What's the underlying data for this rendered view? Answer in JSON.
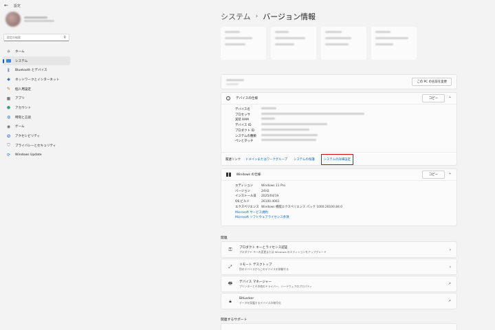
{
  "titlebar": {
    "back": "←",
    "title": "設定"
  },
  "search": {
    "placeholder": "設定の検索"
  },
  "sidebar": {
    "items": [
      {
        "label": "ホーム",
        "icon": "home-icon"
      },
      {
        "label": "システム",
        "icon": "monitor-icon"
      },
      {
        "label": "Bluetooth とデバイス",
        "icon": "bluetooth-icon"
      },
      {
        "label": "ネットワークとインターネット",
        "icon": "wifi-icon"
      },
      {
        "label": "個人用設定",
        "icon": "brush-icon"
      },
      {
        "label": "アプリ",
        "icon": "apps-icon"
      },
      {
        "label": "アカウント",
        "icon": "person-icon"
      },
      {
        "label": "時刻と言語",
        "icon": "globe-icon"
      },
      {
        "label": "ゲーム",
        "icon": "gamepad-icon"
      },
      {
        "label": "アクセシビリティ",
        "icon": "accessibility-icon"
      },
      {
        "label": "プライバシーとセキュリティ",
        "icon": "shield-icon"
      },
      {
        "label": "Windows Update",
        "icon": "update-icon"
      }
    ]
  },
  "header": {
    "system": "システム",
    "separator": "›",
    "page": "バージョン情報"
  },
  "rename_button": "この PC の名前を変更",
  "device_specs": {
    "title": "デバイスの仕様",
    "copy": "コピー",
    "labels": [
      "デバイス名",
      "プロセッサ",
      "実装 RAM",
      "デバイス ID",
      "プロダクト ID",
      "システムの種類",
      "ペンとタッチ"
    ]
  },
  "related_links": {
    "label": "関連リンク",
    "links": [
      "ドメインまたはワークグループ",
      "システムの保護",
      "システムの詳細設定"
    ]
  },
  "windows_specs": {
    "title": "Windows の仕様",
    "copy": "コピー",
    "rows": [
      {
        "label": "エディション",
        "value": "Windows 11 Pro"
      },
      {
        "label": "バージョン",
        "value": "24H2"
      },
      {
        "label": "インストール日",
        "value": "2025/04/19"
      },
      {
        "label": "OS ビルド",
        "value": "26100.4061"
      },
      {
        "label": "エクスペリエンス",
        "value": "Windows 機能エクスペリエンス パック 1000.26100.84.0"
      }
    ],
    "links": [
      "Microsoft サービス規約",
      "Microsoft ソフトウェアライセンス条項"
    ]
  },
  "related": {
    "title": "関連",
    "items": [
      {
        "title": "プロダクト キーとライセンス認証",
        "desc": "プロダクト キーの変更または Windows のエディションをアップグレード",
        "end": "›"
      },
      {
        "title": "リモート デスクトップ",
        "desc": "別のデバイスからこのデバイスを制御する",
        "end": "›"
      },
      {
        "title": "デバイス マネージャー",
        "desc": "プリンターとその他のドライバー、ハードウェアのプロパティ",
        "end": "↗"
      },
      {
        "title": "BitLocker",
        "desc": "データを保護するデバイスの暗号化",
        "end": "↗"
      }
    ]
  },
  "support": {
    "title": "関連するサポート"
  }
}
